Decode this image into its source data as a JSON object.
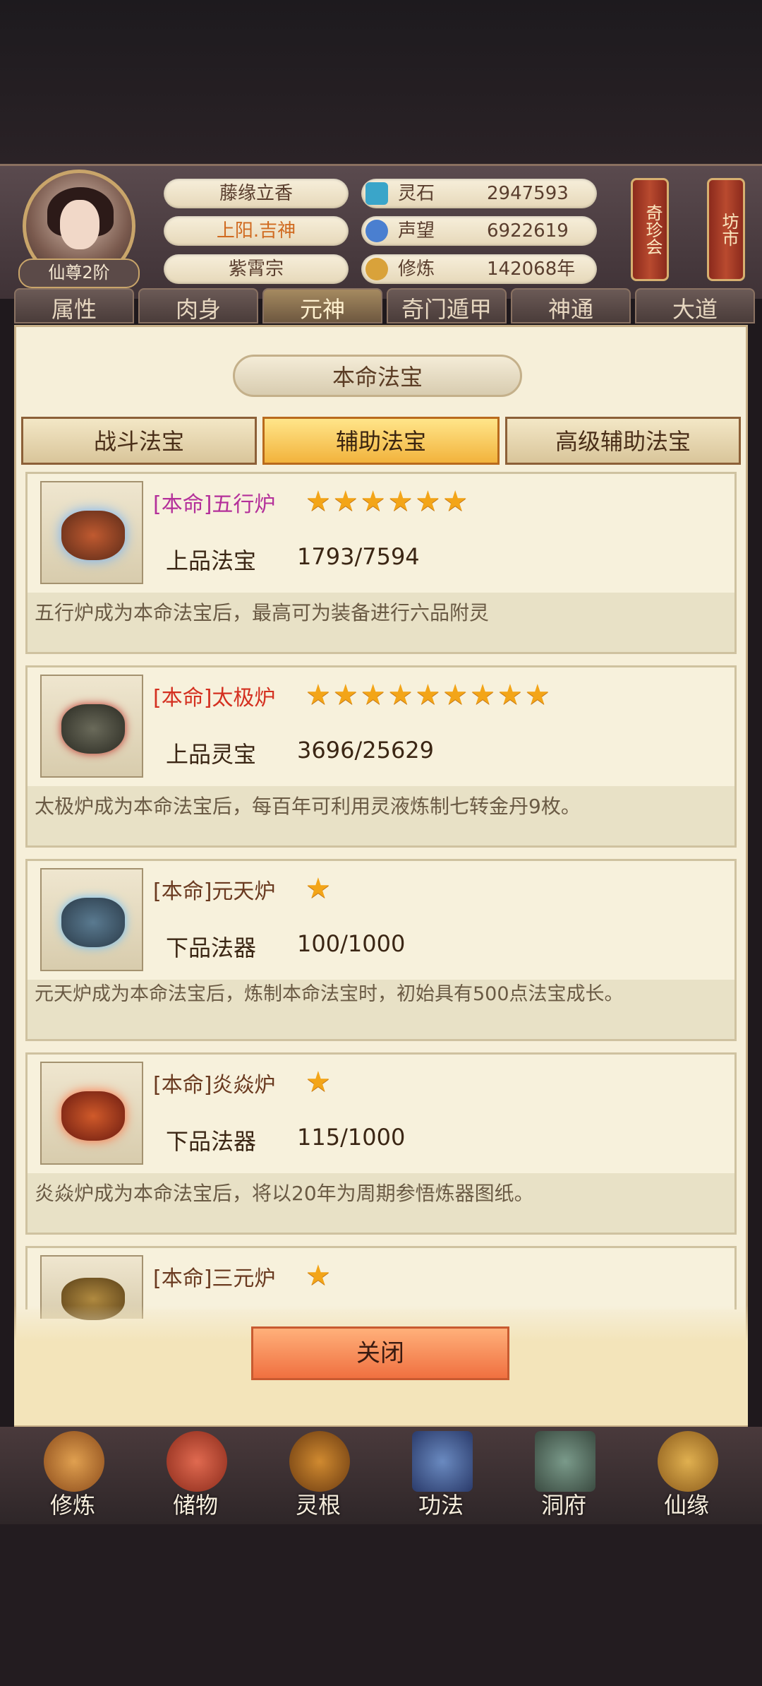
{
  "player": {
    "rank": "仙尊2阶",
    "name": "藤缘立香",
    "title": "上阳.吉神",
    "sect": "紫霄宗"
  },
  "resources": [
    {
      "label": "灵石",
      "value": "2947593",
      "icon": "spirit-stone-icon",
      "color": "#3aa5c9"
    },
    {
      "label": "声望",
      "value": "6922619",
      "icon": "prestige-icon",
      "color": "#4a7fd0"
    },
    {
      "label": "修炼",
      "value": "142068年",
      "icon": "cultivation-icon",
      "color": "#d9a23a"
    }
  ],
  "side_buttons": [
    "奇珍会",
    "坊市"
  ],
  "top_tabs": [
    "属性",
    "肉身",
    "元神",
    "奇门遁甲",
    "神通",
    "大道"
  ],
  "panel": {
    "title": "本命法宝",
    "sub_tabs": [
      "战斗法宝",
      "辅助法宝",
      "高级辅助法宝"
    ],
    "active_sub_tab": 1,
    "items": [
      {
        "name": "[本命]五行炉",
        "name_color": "#b4309a",
        "stars": 6,
        "grade": "上品法宝",
        "progress": "1793/7594",
        "desc": "五行炉成为本命法宝后，最高可为装备进行六品附灵"
      },
      {
        "name": "[本命]太极炉",
        "name_color": "#d43020",
        "stars": 9,
        "grade": "上品灵宝",
        "progress": "3696/25629",
        "desc": "太极炉成为本命法宝后，每百年可利用灵液炼制七转金丹9枚。"
      },
      {
        "name": "[本命]元天炉",
        "name_color": "#6a3a20",
        "stars": 1,
        "grade": "下品法器",
        "progress": "100/1000",
        "desc": "元天炉成为本命法宝后，炼制本命法宝时，初始具有500点法宝成长。"
      },
      {
        "name": "[本命]炎焱炉",
        "name_color": "#6a3a20",
        "stars": 1,
        "grade": "下品法器",
        "progress": "115/1000",
        "desc": "炎焱炉成为本命法宝后，将以20年为周期参悟炼器图纸。"
      },
      {
        "name": "[本命]三元炉",
        "name_color": "#6a3a20",
        "stars": 1,
        "grade": "",
        "progress": "",
        "desc": ""
      }
    ],
    "close_label": "关闭"
  },
  "bottom_nav": [
    "修炼",
    "储物",
    "灵根",
    "功法",
    "洞府",
    "仙缘"
  ]
}
